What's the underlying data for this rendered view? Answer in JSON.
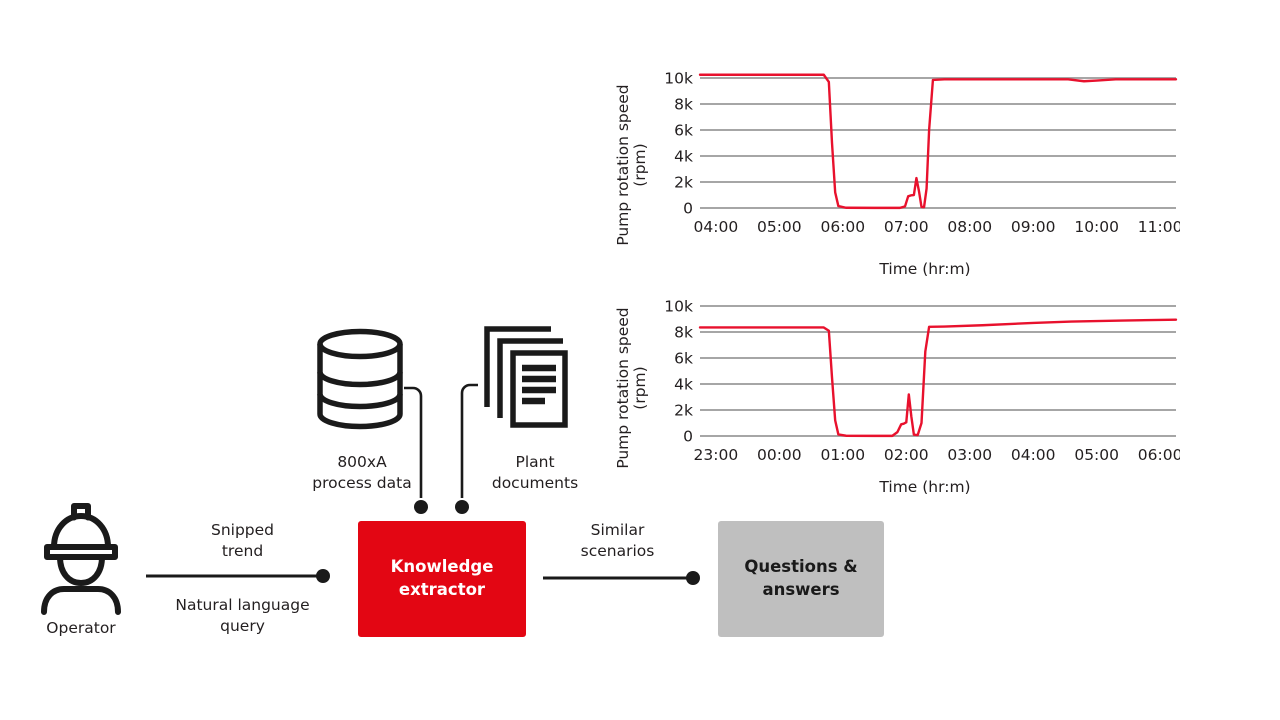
{
  "diagram": {
    "nodes": {
      "operator": {
        "label": "Operator",
        "icon": "operator-hardhat-icon"
      },
      "knowledge_extractor": {
        "label": "Knowledge\nextractor",
        "line1": "Knowledge",
        "line2": "extractor",
        "color": "#E30613"
      },
      "questions_answers": {
        "label": "Questions &\nanswers",
        "line1": "Questions &",
        "line2": "answers",
        "color": "#BFBFBF"
      },
      "process_data": {
        "line1": "800xA",
        "line2": "process data",
        "icon": "database-icon"
      },
      "plant_documents": {
        "line1": "Plant",
        "line2": "documents",
        "icon": "documents-icon"
      }
    },
    "edges": {
      "snipped_trend": {
        "line1": "Snipped",
        "line2": "trend"
      },
      "natural_language_query": {
        "line1": "Natural language",
        "line2": "query"
      },
      "similar_scenarios": {
        "line1": "Similar",
        "line2": "scenarios"
      }
    }
  },
  "chart_data": [
    {
      "id": "chart-1",
      "type": "line",
      "title": "",
      "xlabel": "Time (hr:m)",
      "ylabel": "Pump rotation speed",
      "ylabel2": "(rpm)",
      "yticks": [
        "10k",
        "8k",
        "6k",
        "4k",
        "2k",
        "0"
      ],
      "ytickvalues": [
        10000,
        8000,
        6000,
        4000,
        2000,
        0
      ],
      "ylim": [
        0,
        10000
      ],
      "grid": true,
      "legend": "none",
      "xticks": [
        "04:00",
        "05:00",
        "06:00",
        "07:00",
        "08:00",
        "09:00",
        "10:00",
        "11:00"
      ],
      "xlim": [
        "03:45",
        "11:15"
      ],
      "line_color": "#E8112D",
      "series": [
        {
          "name": "Pump rotation speed",
          "points": [
            [
              3.75,
              10250
            ],
            [
              5.7,
              10250
            ],
            [
              5.78,
              9700
            ],
            [
              5.83,
              5000
            ],
            [
              5.88,
              1200
            ],
            [
              5.93,
              150
            ],
            [
              6.05,
              20
            ],
            [
              6.5,
              10
            ],
            [
              6.9,
              10
            ],
            [
              6.98,
              120
            ],
            [
              7.03,
              900
            ],
            [
              7.08,
              980
            ],
            [
              7.12,
              1000
            ],
            [
              7.16,
              2300
            ],
            [
              7.2,
              1300
            ],
            [
              7.24,
              80
            ],
            [
              7.28,
              60
            ],
            [
              7.32,
              1500
            ],
            [
              7.36,
              6000
            ],
            [
              7.42,
              9850
            ],
            [
              7.6,
              9900
            ],
            [
              9.55,
              9900
            ],
            [
              9.8,
              9750
            ],
            [
              10.0,
              9800
            ],
            [
              10.3,
              9900
            ],
            [
              11.25,
              9900
            ]
          ]
        }
      ]
    },
    {
      "id": "chart-2",
      "type": "line",
      "title": "",
      "xlabel": "Time (hr:m)",
      "ylabel": "Pump rotation speed",
      "ylabel2": "(rpm)",
      "yticks": [
        "10k",
        "8k",
        "6k",
        "4k",
        "2k",
        "0"
      ],
      "ytickvalues": [
        10000,
        8000,
        6000,
        4000,
        2000,
        0
      ],
      "ylim": [
        0,
        10000
      ],
      "grid": true,
      "legend": "none",
      "xticks": [
        "23:00",
        "00:00",
        "01:00",
        "02:00",
        "03:00",
        "04:00",
        "05:00",
        "06:00"
      ],
      "xlim": [
        "22:45",
        "06:15"
      ],
      "line_color": "#E8112D",
      "series": [
        {
          "name": "Pump rotation speed",
          "points": [
            [
              22.75,
              8350
            ],
            [
              0.7,
              8350
            ],
            [
              0.78,
              8100
            ],
            [
              0.83,
              4500
            ],
            [
              0.88,
              1200
            ],
            [
              0.93,
              120
            ],
            [
              1.05,
              20
            ],
            [
              1.5,
              10
            ],
            [
              1.78,
              10
            ],
            [
              1.86,
              300
            ],
            [
              1.92,
              900
            ],
            [
              1.96,
              950
            ],
            [
              2.0,
              1050
            ],
            [
              2.04,
              3200
            ],
            [
              2.08,
              1500
            ],
            [
              2.12,
              100
            ],
            [
              2.18,
              70
            ],
            [
              2.24,
              1000
            ],
            [
              2.3,
              6500
            ],
            [
              2.36,
              8400
            ],
            [
              2.6,
              8420
            ],
            [
              3.2,
              8520
            ],
            [
              4.0,
              8700
            ],
            [
              4.6,
              8800
            ],
            [
              5.4,
              8880
            ],
            [
              6.25,
              8950
            ]
          ]
        }
      ]
    }
  ]
}
